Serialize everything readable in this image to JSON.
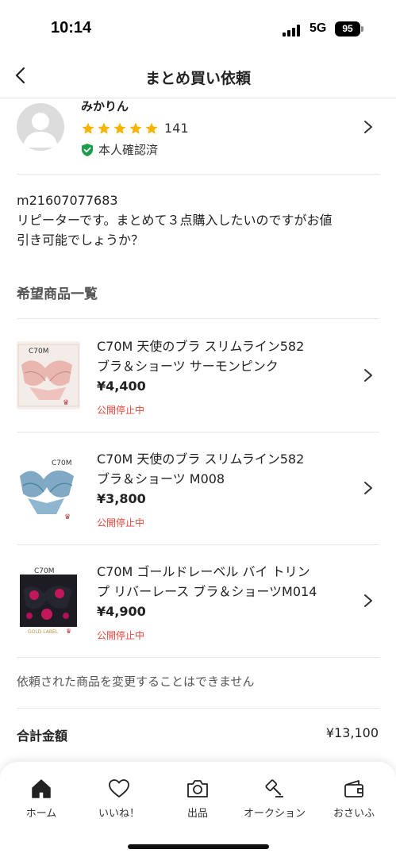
{
  "status_bar": {
    "time": "10:14",
    "network": "5G",
    "battery": "95"
  },
  "header": {
    "title": "まとめ買い依頼"
  },
  "seller": {
    "name": "みかりん",
    "rating_count": "141",
    "stars": 5,
    "verified_label": "本人確認済"
  },
  "message": {
    "line1": "m21607077683",
    "line2": "リピーターです。まとめて３点購入したいのですがお値",
    "line3": "引き可能でしょうか？"
  },
  "section": {
    "title": "希望商品一覧"
  },
  "items": [
    {
      "name_line1": "C70M 天使のブラ スリムライン582",
      "name_line2": "ブラ＆ショーツ サーモンピンク",
      "price": "¥4,400",
      "status": "公開停止中",
      "thumb_text": "C70M",
      "thumb_color": "#e9b7b0"
    },
    {
      "name_line1": "C70M 天使のブラ スリムライン582",
      "name_line2": "ブラ＆ショーツ M008",
      "price": "¥3,800",
      "status": "公開停止中",
      "thumb_text": "C70M",
      "thumb_color": "#7fa9c4"
    },
    {
      "name_line1": "C70M ゴールドレーベル バイ トリン",
      "name_line2": "プ リバーレース ブラ＆ショーツM014",
      "price": "¥4,900",
      "status": "公開停止中",
      "thumb_text": "C70M",
      "thumb_color": "#1c1c22",
      "thumb_caption": "GOLD LABEL"
    }
  ],
  "notice": "依頼された商品を変更することはできません",
  "total": {
    "label": "合計金額",
    "value": "¥13,100"
  },
  "tabbar": {
    "tabs": [
      {
        "label": "ホーム",
        "icon": "home-icon"
      },
      {
        "label": "いいね！",
        "icon": "heart-icon"
      },
      {
        "label": "出品",
        "icon": "camera-icon"
      },
      {
        "label": "オークション",
        "icon": "gavel-icon"
      },
      {
        "label": "おさいふ",
        "icon": "wallet-icon"
      }
    ]
  },
  "colors": {
    "accent_red": "#e8463b",
    "star": "#f8b500",
    "verified_green": "#1a9e4a"
  }
}
